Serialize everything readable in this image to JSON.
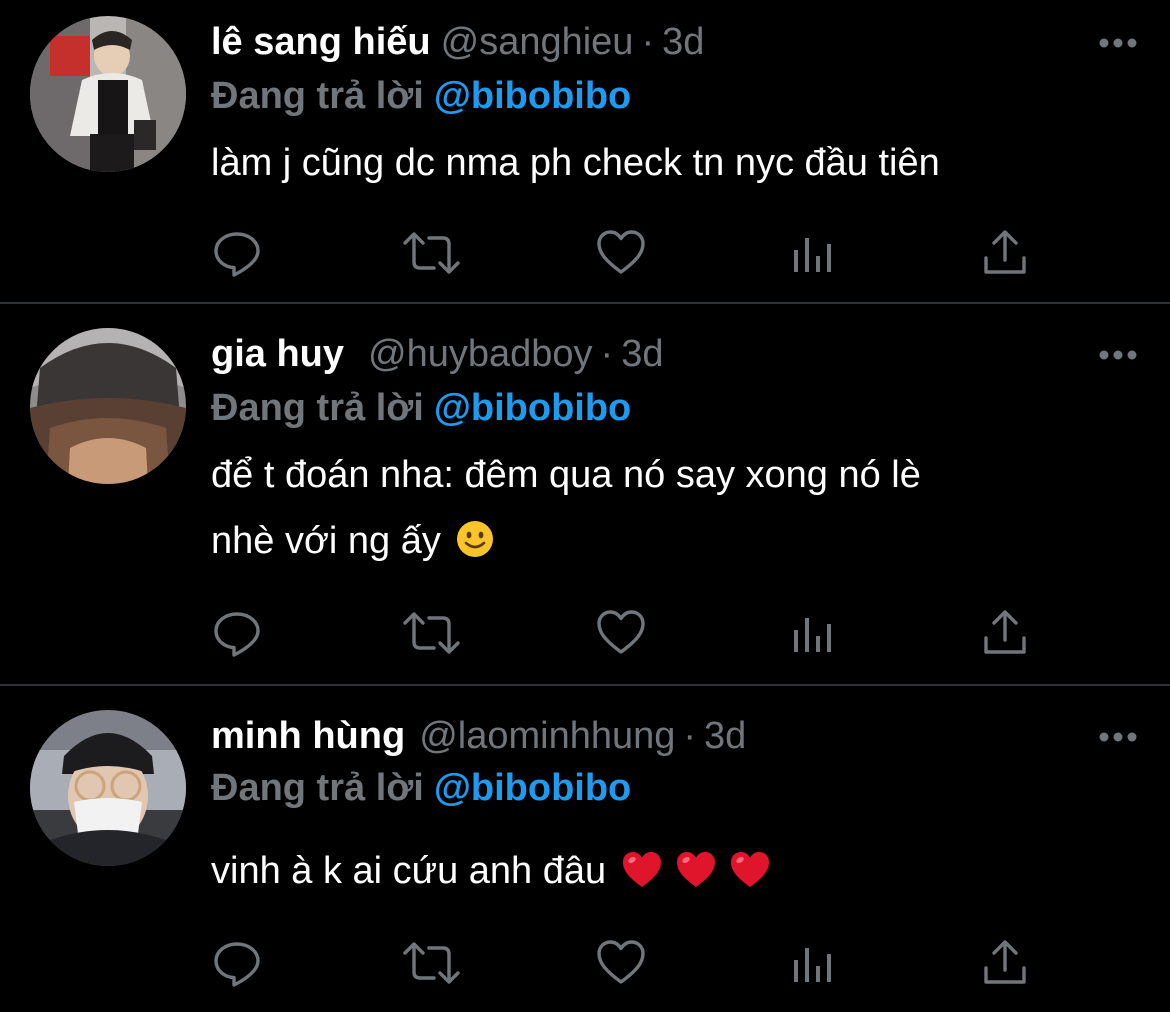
{
  "tweets": [
    {
      "name": "lê sang hiếu",
      "handle": "@sanghieu",
      "separator": "·",
      "time": "3d",
      "reply_prefix": "Đang trả lời",
      "reply_mention": "@bibobibo",
      "lines": [
        "làm j cũng dc nma ph check tn nyc đầu tiên"
      ]
    },
    {
      "name": "gia huy",
      "handle": "@huybadboy",
      "separator": "·",
      "time": "3d",
      "reply_prefix": "Đang trả lời",
      "reply_mention": "@bibobibo",
      "lines": [
        "để t đoán nha: đêm qua nó say xong nó lè",
        "nhè với ng ấy"
      ],
      "emojis": [
        "slightly-smiling-face"
      ]
    },
    {
      "name": "minh hùng",
      "handle": "@laominhhung",
      "separator": "·",
      "time": "3d",
      "reply_prefix": "Đang trả lời",
      "reply_mention": "@bibobibo",
      "lines": [
        "vinh à k ai cứu anh đâu"
      ],
      "emojis": [
        "red-heart",
        "red-heart",
        "red-heart"
      ]
    }
  ],
  "icons": {
    "more": "more-horizontal-icon",
    "reply": "reply-icon",
    "retweet": "retweet-icon",
    "like": "heart-icon",
    "views": "views-icon",
    "share": "share-icon"
  },
  "colors": {
    "background": "#000000",
    "name": "#ffffff",
    "secondary": "#71767b",
    "mention": "#1d9bf0",
    "divider": "#2f3336",
    "heart_emoji": "#e0142b",
    "smile_emoji": "#f9c52b"
  }
}
